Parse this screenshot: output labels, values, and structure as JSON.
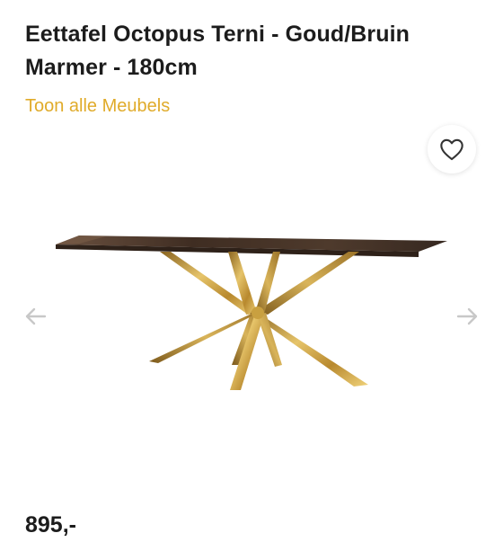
{
  "product": {
    "title": "Eettafel Octopus Terni - Goud/Bruin Marmer - 180cm",
    "category_link": "Toon alle Meubels",
    "price": "895,-"
  },
  "icons": {
    "wishlist": "heart-outline-icon",
    "previous": "arrow-left-icon",
    "next": "arrow-right-icon"
  },
  "colors": {
    "accent": "#e0ab2a",
    "text": "#1c1c1c",
    "arrow": "#c8c8c8",
    "gold": "#c8a040",
    "marble": "#4a3628"
  }
}
